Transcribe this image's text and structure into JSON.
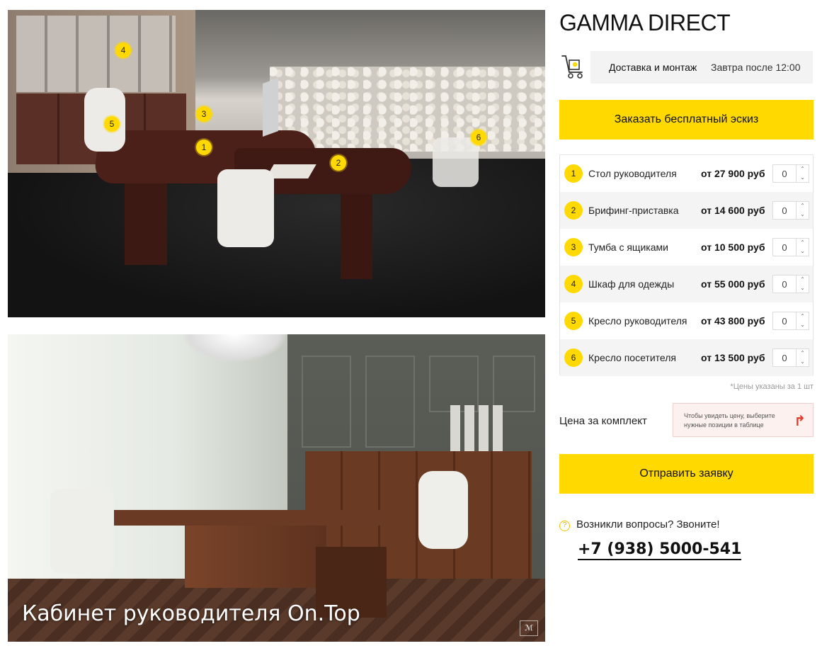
{
  "brand": "GAMMA DIRECT",
  "colors": {
    "accent": "#ffd900",
    "hint_bg": "#fdf1f0",
    "hint_arrow": "#e23a2a"
  },
  "delivery": {
    "icon": "truck-icon",
    "label": "Доставка и монтаж",
    "value": "Завтра после 12:00"
  },
  "sketch_button": "Заказать бесплатный эскиз",
  "products": [
    {
      "num": "1",
      "name": "Стол руководителя",
      "price": "от 27 900 руб",
      "qty": "0"
    },
    {
      "num": "2",
      "name": "Брифинг-приставка",
      "price": "от 14 600 руб",
      "qty": "0"
    },
    {
      "num": "3",
      "name": "Тумба с ящиками",
      "price": "от 10 500 руб",
      "qty": "0"
    },
    {
      "num": "4",
      "name": "Шкаф для одежды",
      "price": "от 55 000 руб",
      "qty": "0"
    },
    {
      "num": "5",
      "name": "Кресло руководителя",
      "price": "от 43 800 руб",
      "qty": "0"
    },
    {
      "num": "6",
      "name": "Кресло посетителя",
      "price": "от 13 500 руб",
      "qty": "0"
    }
  ],
  "price_note": "*Цены указаны за 1 шт",
  "kit": {
    "label": "Цена за комплект",
    "hint": "Чтобы увидеть цену, выберите нужные позиции в таблице"
  },
  "submit_button": "Отправить заявку",
  "contact": {
    "question": "Возникли вопросы? Звоните!",
    "phone": "+7 (938) 5000-541"
  },
  "gallery": {
    "markers": [
      "1",
      "2",
      "3",
      "4",
      "5",
      "6"
    ],
    "caption": "Кабинет руководителя On.Top"
  }
}
